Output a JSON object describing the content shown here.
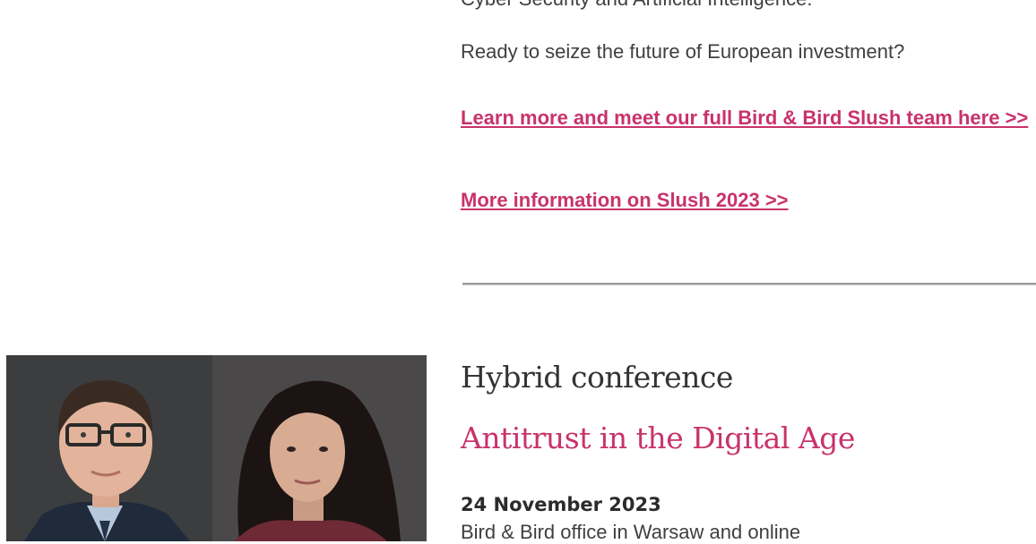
{
  "intro": {
    "cut_line": "Cyber Security and Artificial Intelligence.",
    "question": "Ready to seize the future of European investment?"
  },
  "links": {
    "learn_more": "Learn more and meet our full Bird & Bird Slush team here >>",
    "more_info": "More information on Slush 2023 >>"
  },
  "event": {
    "type": "Hybrid conference",
    "title": "Antitrust in the Digital Age",
    "date": "24 November 2023",
    "location": "Bird & Bird office in Warsaw and online"
  },
  "colors": {
    "accent": "#c8336a",
    "text": "#3f3f3f",
    "divider": "#9a9a9a"
  }
}
